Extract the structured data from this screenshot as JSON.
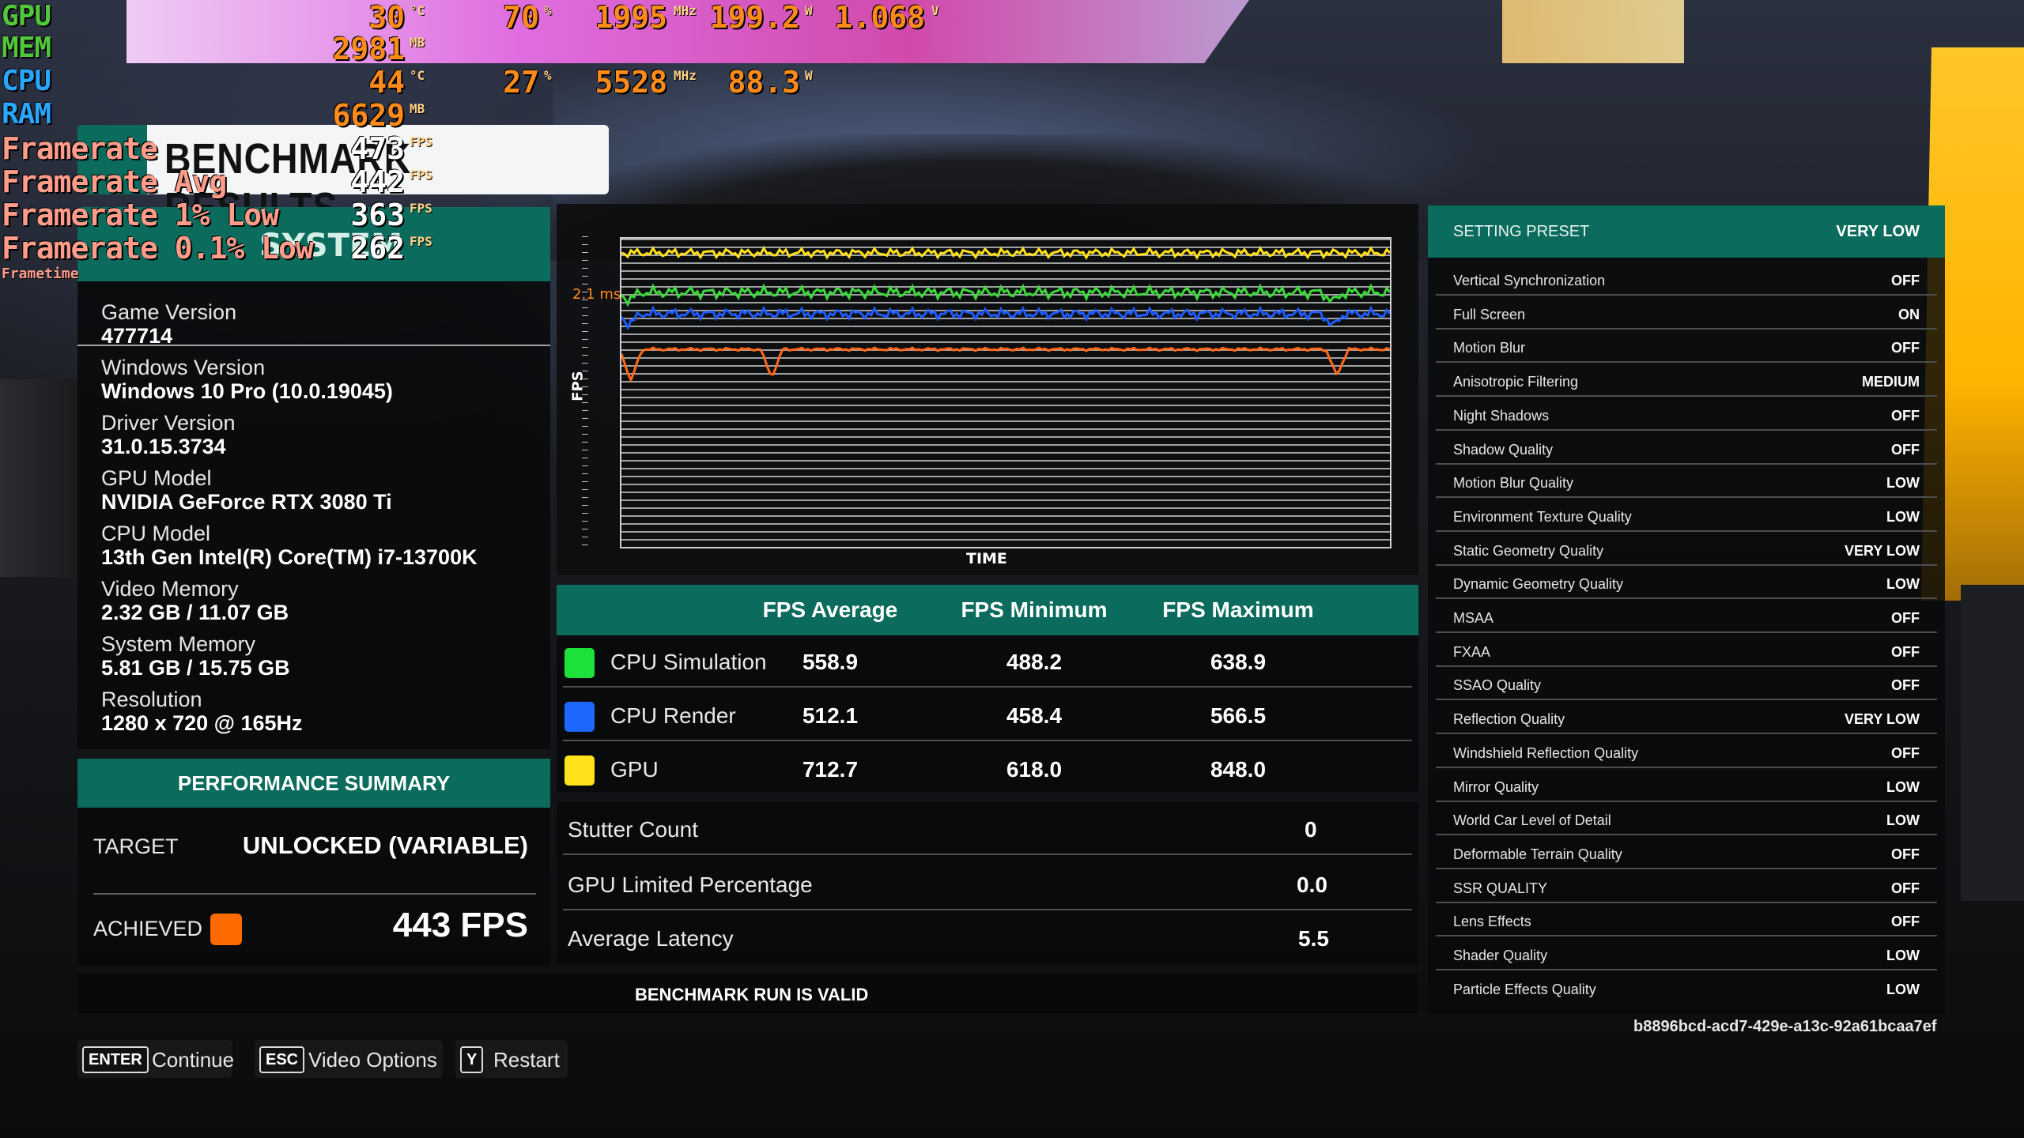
{
  "osd": {
    "gpu": {
      "label": "GPU",
      "temp": "30",
      "temp_unit": "°C",
      "load": "70",
      "load_unit": "%",
      "clock": "1995",
      "clock_unit": "MHz",
      "power": "199.2",
      "power_unit": "W",
      "voltage": "1.068",
      "voltage_unit": "V"
    },
    "mem": {
      "label": "MEM",
      "value": "2981",
      "unit": "MB"
    },
    "cpu": {
      "label": "CPU",
      "temp": "44",
      "temp_unit": "°C",
      "load": "27",
      "load_unit": "%",
      "clock": "5528",
      "clock_unit": "MHz",
      "power": "88.3",
      "power_unit": "W"
    },
    "ram": {
      "label": "RAM",
      "value": "6629",
      "unit": "MB"
    },
    "framerate": {
      "label": "Framerate",
      "value": "473",
      "unit": "FPS"
    },
    "framerate_avg": {
      "label": "Framerate Avg",
      "value": "442",
      "unit": "FPS"
    },
    "framerate_1": {
      "label": "Framerate 1% Low",
      "value": "363",
      "unit": "FPS"
    },
    "framerate_01": {
      "label": "Framerate 0.1% Low",
      "value": "262",
      "unit": "FPS"
    },
    "frametime": {
      "label": "Frametime"
    }
  },
  "title": "BENCHMARK RESULTS",
  "system": {
    "header": "SYSTEM",
    "items": [
      {
        "k": "Game Version",
        "v": "477714"
      },
      {
        "k": "Windows Version",
        "v": "Windows 10 Pro (10.0.19045)"
      },
      {
        "k": "Driver Version",
        "v": "31.0.15.3734"
      },
      {
        "k": "GPU Model",
        "v": "NVIDIA GeForce RTX 3080 Ti"
      },
      {
        "k": "CPU Model",
        "v": "13th Gen Intel(R) Core(TM) i7-13700K"
      },
      {
        "k": "Video Memory",
        "v": "2.32 GB / 11.07 GB"
      },
      {
        "k": "System Memory",
        "v": "5.81 GB / 15.75 GB"
      },
      {
        "k": "Resolution",
        "v": "1280 x 720 @ 165Hz"
      }
    ]
  },
  "performance": {
    "header": "PERFORMANCE SUMMARY",
    "target_label": "TARGET",
    "target_value": "UNLOCKED (VARIABLE)",
    "achieved_label": "ACHIEVED",
    "achieved_value": "443 FPS",
    "achieved_color": "#ff6a00"
  },
  "graph": {
    "y_label": "FPS",
    "x_label": "TIME",
    "ms_marker": "2.1 ms",
    "series_colors": {
      "cpu_simulation": "#3ed83e",
      "cpu_render": "#1f5cff",
      "gpu": "#ffe01a",
      "frametime": "#ff6a1a"
    }
  },
  "fps_table": {
    "headers": [
      "FPS Average",
      "FPS Minimum",
      "FPS Maximum"
    ],
    "rows": [
      {
        "name": "CPU Simulation",
        "color": "#1ee03a",
        "avg": "558.9",
        "min": "488.2",
        "max": "638.9"
      },
      {
        "name": "CPU Render",
        "color": "#1f68ff",
        "avg": "512.1",
        "min": "458.4",
        "max": "566.5"
      },
      {
        "name": "GPU",
        "color": "#ffe21a",
        "avg": "712.7",
        "min": "618.0",
        "max": "848.0"
      }
    ]
  },
  "stats": [
    {
      "k": "Stutter Count",
      "v": "0"
    },
    {
      "k": "GPU Limited Percentage",
      "v": "0.0"
    },
    {
      "k": "Average Latency",
      "v": "5.5"
    }
  ],
  "valid_text": "BENCHMARK RUN IS VALID",
  "settings": {
    "preset_label": "SETTING PRESET",
    "preset_value": "VERY LOW",
    "items": [
      {
        "k": "Vertical Synchronization",
        "v": "OFF"
      },
      {
        "k": "Full Screen",
        "v": "ON"
      },
      {
        "k": "Motion Blur",
        "v": "OFF"
      },
      {
        "k": "Anisotropic Filtering",
        "v": "MEDIUM"
      },
      {
        "k": "Night Shadows",
        "v": "OFF"
      },
      {
        "k": "Shadow Quality",
        "v": "OFF"
      },
      {
        "k": "Motion Blur Quality",
        "v": "LOW"
      },
      {
        "k": "Environment Texture Quality",
        "v": "LOW"
      },
      {
        "k": "Static Geometry Quality",
        "v": "VERY LOW"
      },
      {
        "k": "Dynamic Geometry Quality",
        "v": "LOW"
      },
      {
        "k": "MSAA",
        "v": "OFF"
      },
      {
        "k": "FXAA",
        "v": "OFF"
      },
      {
        "k": "SSAO Quality",
        "v": "OFF"
      },
      {
        "k": "Reflection Quality",
        "v": "VERY LOW"
      },
      {
        "k": "Windshield Reflection Quality",
        "v": "OFF"
      },
      {
        "k": "Mirror Quality",
        "v": "LOW"
      },
      {
        "k": "World Car Level of Detail",
        "v": "LOW"
      },
      {
        "k": "Deformable Terrain Quality",
        "v": "OFF"
      },
      {
        "k": "SSR QUALITY",
        "v": "OFF"
      },
      {
        "k": "Lens Effects",
        "v": "OFF"
      },
      {
        "k": "Shader Quality",
        "v": "LOW"
      },
      {
        "k": "Particle Effects Quality",
        "v": "LOW"
      }
    ]
  },
  "hash": "b8896bcd-acd7-429e-a13c-92a61bcaa7ef",
  "footer": {
    "continue_key": "ENTER",
    "continue_label": "Continue",
    "options_key": "ESC",
    "options_label": "Video Options",
    "restart_key": "Y",
    "restart_label": "Restart"
  }
}
